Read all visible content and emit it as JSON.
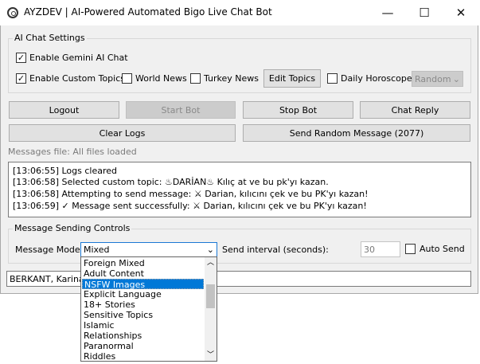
{
  "window": {
    "title": "AYZDEV | AI-Powered Automated Bigo Live Chat Bot",
    "minimize": "—",
    "maximize": "☐",
    "close": "✕"
  },
  "ai_settings": {
    "legend": "AI Chat Settings",
    "enable_gemini": {
      "label": "Enable Gemini AI Chat",
      "checked": true
    },
    "enable_custom_topics": {
      "label": "Enable Custom Topics",
      "checked": true
    },
    "world_news": {
      "label": "World News",
      "checked": false
    },
    "turkey_news": {
      "label": "Turkey News",
      "checked": false
    },
    "edit_topics": "Edit Topics",
    "daily_horoscope": {
      "label": "Daily Horoscope",
      "checked": false
    },
    "horoscope_select": "Random"
  },
  "buttons": {
    "logout": "Logout",
    "start_bot": "Start Bot",
    "stop_bot": "Stop Bot",
    "chat_reply": "Chat Reply",
    "clear_logs": "Clear Logs",
    "send_random": "Send Random Message (2077)"
  },
  "messages_file": "Messages file: All files loaded",
  "logs": [
    "[13:06:55] Logs cleared",
    "[13:06:58] Selected custom topic: ♨DARİAN♨ Kılıç at ve bu pk'yı kazan.",
    "[13:06:58] Attempting to send message: ⚔ Darian, kılıcını çek ve bu PK'yı kazan!",
    "[13:06:59] ✓ Message sent successfully: ⚔ Darian, kılıcını çek ve bu PK'yı kazan!"
  ],
  "sending": {
    "legend": "Message Sending Controls",
    "mode_label": "Message Mode:",
    "mode_value": "Mixed",
    "interval_label": "Send interval (seconds):",
    "interval_value": "30",
    "auto_send": {
      "label": "Auto Send",
      "checked": false
    }
  },
  "bottom_input": "BERKANT, Karina &",
  "mode_options": [
    "Foreign Mixed",
    "Adult Content",
    "NSFW Images",
    "Explicit Language",
    "18+ Stories",
    "Sensitive Topics",
    "Islamic",
    "Relationships",
    "Paranormal",
    "Riddles"
  ],
  "selected_option": "NSFW Images"
}
